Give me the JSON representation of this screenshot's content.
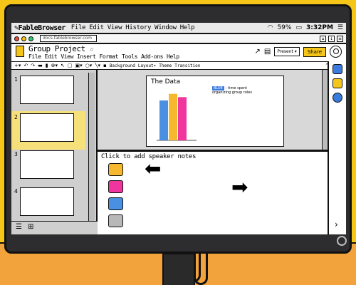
{
  "browser": {
    "brand": "FableBrowser",
    "menu": [
      "File",
      "Edit",
      "View",
      "History",
      "Window",
      "Help"
    ],
    "battery": "59%",
    "time": "3:32PM",
    "url": "docs.fablebrowser.com"
  },
  "doc": {
    "title": "Group Project",
    "menu": [
      "File",
      "Edit",
      "View",
      "Insert",
      "Format",
      "Tools",
      "Add-ons",
      "Help"
    ],
    "present_label": "Present",
    "share_label": "Share"
  },
  "toolbar": {
    "background": "Background",
    "layout": "Layout",
    "theme": "Theme",
    "transition": "Transition"
  },
  "slides": {
    "numbers": [
      "1",
      "2",
      "3",
      "4"
    ],
    "selected": 2
  },
  "slide": {
    "title": "The Data",
    "legend_tag": "BLUE",
    "legend_line1": "- time spent",
    "legend_line2": "organizing group roles"
  },
  "chart_data": {
    "type": "bar",
    "categories": [
      "",
      "",
      ""
    ],
    "values": [
      48,
      56,
      52
    ],
    "colors": [
      "#4a90e2",
      "#f5b82e",
      "#f0359e"
    ],
    "ylim": [
      0,
      60
    ],
    "title": "",
    "xlabel": "",
    "ylabel": "",
    "grid": false
  },
  "notes": {
    "placeholder": "Click to add speaker notes",
    "swatches": [
      "#f5b82e",
      "#f0359e",
      "#4a90e2",
      "#b8b8b8"
    ]
  },
  "colors": {
    "accent": "#f5c518",
    "wall": "#f5c518",
    "desk": "#f2a33c"
  }
}
